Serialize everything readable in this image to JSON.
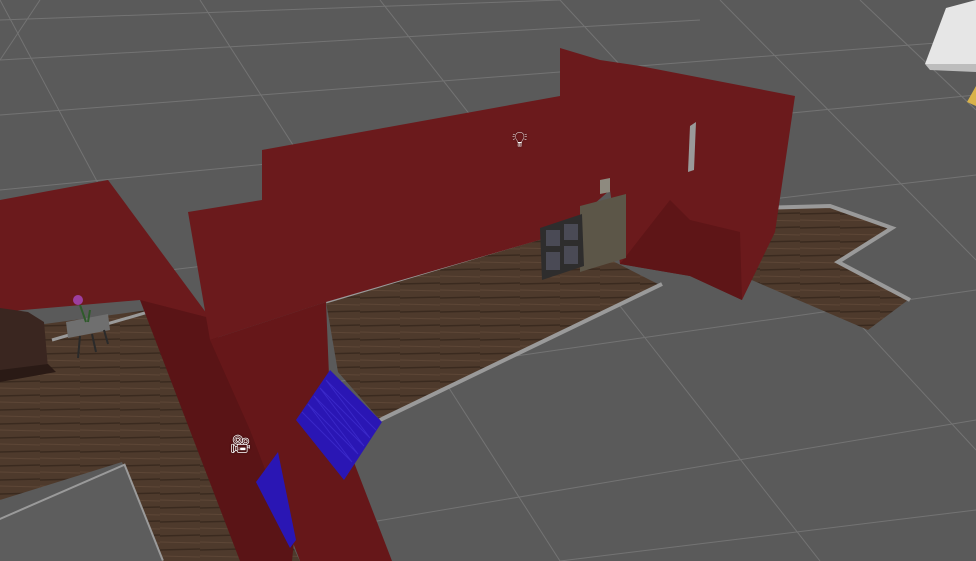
{
  "viewport": {
    "background_color": "#5a5a5a",
    "grid_color": "#7a7a7a"
  },
  "colors": {
    "wall": "#6b1a1c",
    "wall_dark": "#5a1416",
    "floor": "#4e3a2c",
    "floor_dark": "#3f2e22",
    "floor_border": "#9a9a9a",
    "stairs": "#2a16b4",
    "door": "#5c5648",
    "bookshelf": "#3b3a3a",
    "table": "#3e2a20",
    "flower": "#9c3fa0"
  },
  "gizmos": {
    "light_icon": "light-bulb-icon",
    "camera_icon": "camera-icon"
  },
  "objects": [
    "walls",
    "wooden-floor",
    "stairs",
    "door",
    "bookshelf",
    "table",
    "flower-vase",
    "corner-block"
  ]
}
